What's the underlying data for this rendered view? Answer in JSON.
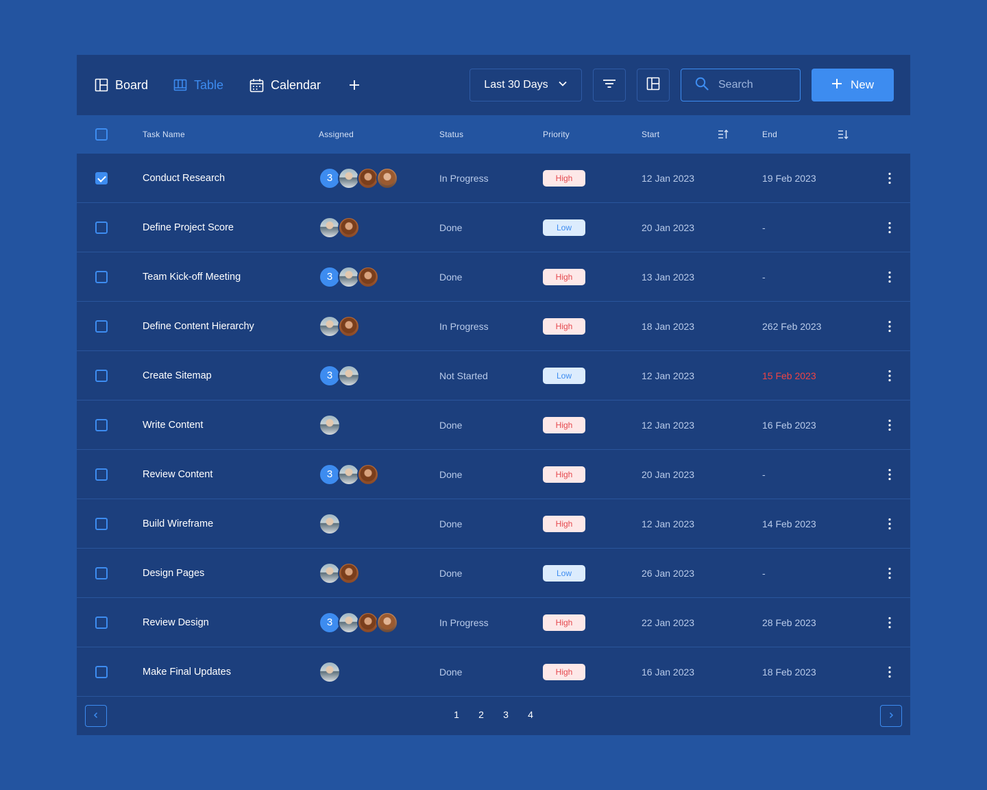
{
  "toolbar": {
    "tabs": [
      {
        "label": "Board",
        "icon": "board-icon",
        "active": false
      },
      {
        "label": "Table",
        "icon": "table-icon",
        "active": true
      },
      {
        "label": "Calendar",
        "icon": "calendar-icon",
        "active": false
      }
    ],
    "add_view_icon": "plus-icon",
    "date_range": "Last 30 Days",
    "filter_icon": "filter-icon",
    "layout_icon": "layout-icon",
    "search_placeholder": "Search",
    "new_label": "New"
  },
  "columns": {
    "task_name": "Task Name",
    "assigned": "Assigned",
    "status": "Status",
    "priority": "Priority",
    "start": "Start",
    "end": "End"
  },
  "rows": [
    {
      "checked": true,
      "task": "Conduct Research",
      "count": "3",
      "avatars": [
        "p1",
        "p2",
        "p3"
      ],
      "status": "In Progress",
      "priority": "High",
      "start": "12 Jan 2023",
      "end": "19 Feb 2023",
      "overdue": false
    },
    {
      "checked": false,
      "task": "Define Project Score",
      "count": null,
      "avatars": [
        "p1",
        "p2"
      ],
      "status": "Done",
      "priority": "Low",
      "start": "20 Jan 2023",
      "end": "-",
      "overdue": false
    },
    {
      "checked": false,
      "task": "Team Kick-off Meeting",
      "count": "3",
      "avatars": [
        "p1",
        "p2"
      ],
      "status": "Done",
      "priority": "High",
      "start": "13 Jan 2023",
      "end": "-",
      "overdue": false
    },
    {
      "checked": false,
      "task": "Define Content Hierarchy",
      "count": null,
      "avatars": [
        "p1",
        "p2"
      ],
      "status": "In Progress",
      "priority": "High",
      "start": "18 Jan 2023",
      "end": "262 Feb 2023",
      "overdue": false
    },
    {
      "checked": false,
      "task": "Create Sitemap",
      "count": "3",
      "avatars": [
        "p1"
      ],
      "status": "Not Started",
      "priority": "Low",
      "start": "12 Jan 2023",
      "end": "15 Feb 2023",
      "overdue": true
    },
    {
      "checked": false,
      "task": "Write Content",
      "count": null,
      "avatars": [
        "p1"
      ],
      "status": "Done",
      "priority": "High",
      "start": "12 Jan 2023",
      "end": "16 Feb 2023",
      "overdue": false
    },
    {
      "checked": false,
      "task": "Review Content",
      "count": "3",
      "avatars": [
        "p1",
        "p2"
      ],
      "status": "Done",
      "priority": "High",
      "start": "20 Jan 2023",
      "end": "-",
      "overdue": false
    },
    {
      "checked": false,
      "task": "Build Wireframe",
      "count": null,
      "avatars": [
        "p1"
      ],
      "status": "Done",
      "priority": "High",
      "start": "12 Jan 2023",
      "end": "14 Feb 2023",
      "overdue": false
    },
    {
      "checked": false,
      "task": "Design Pages",
      "count": null,
      "avatars": [
        "p1",
        "p2"
      ],
      "status": "Done",
      "priority": "Low",
      "start": "26 Jan 2023",
      "end": "-",
      "overdue": false
    },
    {
      "checked": false,
      "task": "Review Design",
      "count": "3",
      "avatars": [
        "p1",
        "p2",
        "p3"
      ],
      "status": "In Progress",
      "priority": "High",
      "start": "22 Jan 2023",
      "end": "28 Feb 2023",
      "overdue": false
    },
    {
      "checked": false,
      "task": "Make Final Updates",
      "count": null,
      "avatars": [
        "p1"
      ],
      "status": "Done",
      "priority": "High",
      "start": "16 Jan 2023",
      "end": "18 Feb 2023",
      "overdue": false
    }
  ],
  "pagination": {
    "pages": [
      "1",
      "2",
      "3",
      "4"
    ],
    "prev_icon": "chevron-left-icon",
    "next_icon": "chevron-right-icon"
  },
  "colors": {
    "background": "#2354a0",
    "panel": "#1c3f7d",
    "accent": "#3d8cf0",
    "high": "#e5484d",
    "low": "#3d8cf0",
    "overdue": "#ef4444"
  }
}
